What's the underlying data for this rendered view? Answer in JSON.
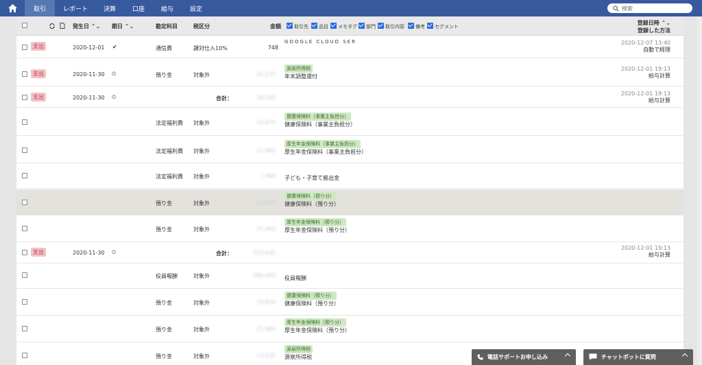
{
  "nav": {
    "items": [
      "取引",
      "レポート",
      "決算",
      "口座",
      "給与",
      "設定"
    ],
    "active": 0,
    "search_placeholder": "検索"
  },
  "header": {
    "date": "発生日",
    "due": "期日",
    "account": "勘定科目",
    "tax": "税区分",
    "amount": "金額",
    "filters": [
      "取引先",
      "品目",
      "メモタグ",
      "部門",
      "取引内容",
      "備考",
      "セグメント"
    ],
    "registered_line1": "登録日時",
    "registered_line2": "登録した方法"
  },
  "rows": [
    {
      "badge": "支出",
      "date": "2020-12-01",
      "status": "✔",
      "account": "通信費",
      "tax": "課対仕入10%",
      "amount": "748",
      "tag": "",
      "desc": "GOOGLE CLOUD SER",
      "reg_date": "2020-12-07 13:40",
      "method": "自動で経理"
    },
    {
      "badge": "支出",
      "date": "2020-11-30",
      "status": "⏲",
      "account": "預り金",
      "tax": "対象外",
      "amount": "15,175",
      "tag": "源泉所得税",
      "desc": "年末調整還付",
      "reg_date": "2020-12-01 19:13",
      "method": "給与計算"
    },
    {
      "badge": "支出",
      "date": "2020-11-30",
      "status": "⏲",
      "total": "合計：",
      "amount": "38,769",
      "reg_date": "2020-12-01 19:13",
      "method": "給与計算"
    },
    {
      "account": "法定福利費",
      "tax": "対象外",
      "amount": "10,870",
      "tag": "健康保険料（事業主負担分）",
      "desc": "健康保険料（事業主負担分）"
    },
    {
      "account": "法定福利費",
      "tax": "対象外",
      "amount": "21,960",
      "tag": "厚生年金保険料（事業主負担分）",
      "desc": "厚生年金保険料（事業主負担分）"
    },
    {
      "account": "法定福利費",
      "tax": "対象外",
      "amount": "1,980",
      "tag": "",
      "desc": "子ども・子育て拠出金"
    },
    {
      "account": "預り金",
      "tax": "対象外",
      "amount": "10,870",
      "tag": "健康保険料（預り分）",
      "desc": "健康保険料（預り分）"
    },
    {
      "account": "預り金",
      "tax": "対象外",
      "amount": "21,960",
      "tag": "厚生年金保険料（預り分）",
      "desc": "厚生年金保険料（預り分）"
    },
    {
      "badge": "支出",
      "date": "2020-11-30",
      "status": "⏲",
      "total": "合計：",
      "amount": "333,635",
      "reg_date": "2020-12-01 19:13",
      "method": "給与計算"
    },
    {
      "account": "役員報酬",
      "tax": "対象外",
      "amount": "380,000",
      "tag": "",
      "desc": "役員報酬"
    },
    {
      "account": "預り金",
      "tax": "対象外",
      "amount": "10,870",
      "tag": "健康保険料（預り分）",
      "desc": "健康保険料（預り分）"
    },
    {
      "account": "預り金",
      "tax": "対象外",
      "amount": "21,960",
      "tag": "厚生年金保険料（預り分）",
      "desc": "厚生年金保険料（預り分）"
    },
    {
      "account": "預り金",
      "tax": "対象外",
      "amount": "13,535",
      "tag": "源泉所得税",
      "desc": "源泉所得税"
    }
  ],
  "bottom": {
    "phone": "電話サポートお申し込み",
    "chat": "チャットボットに質問"
  }
}
